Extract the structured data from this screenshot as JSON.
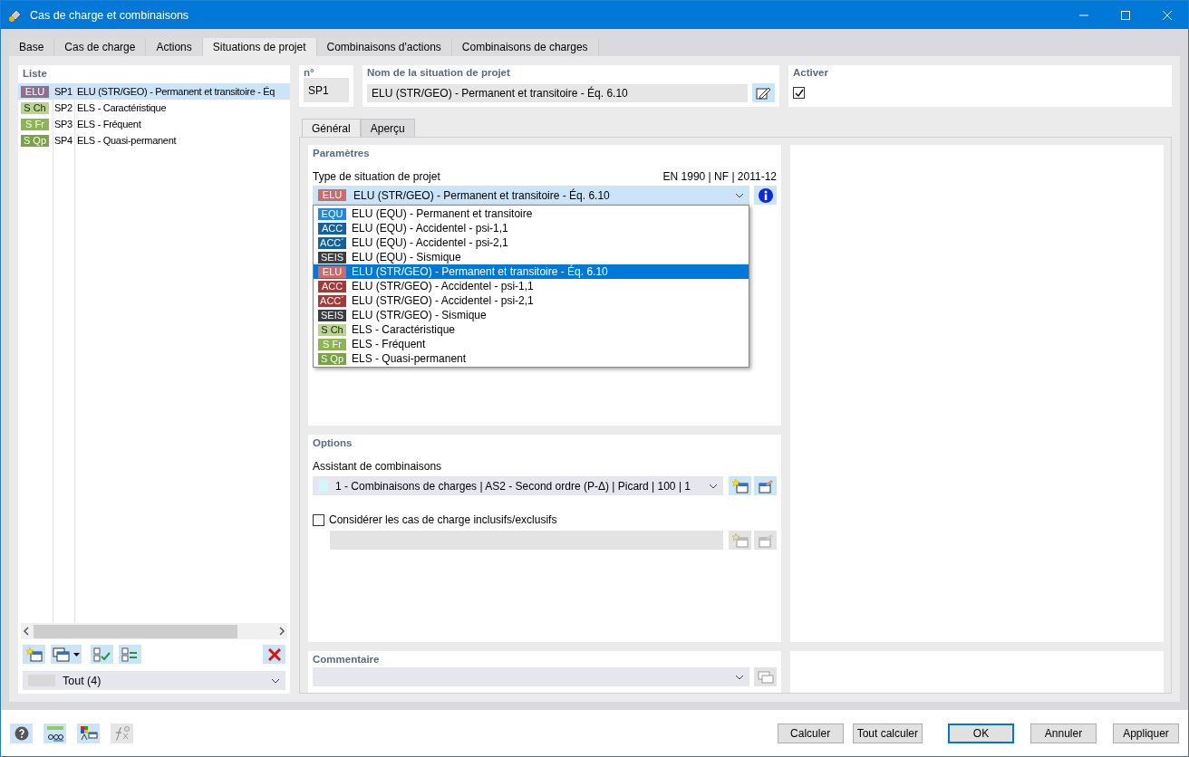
{
  "window": {
    "title": "Cas de charge et combinaisons"
  },
  "tabs": [
    {
      "label": "Base",
      "selected": false
    },
    {
      "label": "Cas de charge",
      "selected": false
    },
    {
      "label": "Actions",
      "selected": false
    },
    {
      "label": "Situations de projet",
      "selected": true
    },
    {
      "label": "Combinaisons d'actions",
      "selected": false
    },
    {
      "label": "Combinaisons de charges",
      "selected": false
    }
  ],
  "list": {
    "header": "Liste",
    "items": [
      {
        "badge": "ELU",
        "color": "#8e6f8e",
        "id": "SP1",
        "name": "ELU (STR/GEO) - Permanent et transitoire - Éq",
        "selected": true
      },
      {
        "badge": "S Ch",
        "color": "#b9d48e",
        "id": "SP2",
        "name": "ELS - Caractéristique",
        "selected": false
      },
      {
        "badge": "S Fr",
        "color": "#8db552",
        "id": "SP3",
        "name": "ELS - Fréquent",
        "selected": false
      },
      {
        "badge": "S Qp",
        "color": "#79a345",
        "id": "SP4",
        "name": "ELS - Quasi-permanent",
        "selected": false
      }
    ],
    "filter": "Tout (4)"
  },
  "number": {
    "label": "n°",
    "value": "SP1"
  },
  "name": {
    "label": "Nom de la situation de projet",
    "value": "ELU (STR/GEO) - Permanent et transitoire - Éq. 6.10"
  },
  "activate": {
    "label": "Activer",
    "checked": true
  },
  "inner_tabs": [
    {
      "label": "Général",
      "selected": true
    },
    {
      "label": "Aperçu",
      "selected": false
    }
  ],
  "parameters": {
    "title": "Paramètres",
    "type_label": "Type de situation de projet",
    "norm": "EN 1990 | NF | 2011-12",
    "value": {
      "badge": "ELU",
      "color": "#cd6b6b",
      "text": "ELU (STR/GEO) - Permanent et transitoire - Éq. 6.10"
    },
    "options": [
      {
        "badge": "EQU",
        "color": "#1e88e5",
        "text": "ELU (EQU) - Permanent et transitoire",
        "selected": false
      },
      {
        "badge": "ACC",
        "color": "#15609e",
        "text": "ELU (EQU) - Accidentel - psi-1,1",
        "selected": false
      },
      {
        "badge": "ACC´",
        "color": "#15609e",
        "text": "ELU (EQU) - Accidentel - psi-2,1",
        "selected": false
      },
      {
        "badge": "SEIS",
        "color": "#3a3c40",
        "text": "ELU (EQU) - Sismique",
        "selected": false
      },
      {
        "badge": "ELU",
        "color": "#cd6b6b",
        "text": "ELU (STR/GEO) - Permanent et transitoire - Éq. 6.10",
        "selected": true
      },
      {
        "badge": "ACC",
        "color": "#a33a3a",
        "text": "ELU (STR/GEO) - Accidentel - psi-1,1",
        "selected": false
      },
      {
        "badge": "ACC´",
        "color": "#a33a3a",
        "text": "ELU (STR/GEO) - Accidentel - psi-2,1",
        "selected": false
      },
      {
        "badge": "SEIS",
        "color": "#3a3c40",
        "text": "ELU (STR/GEO) - Sismique",
        "selected": false
      },
      {
        "badge": "S Ch",
        "color": "#b9d48e",
        "text": "ELS - Caractéristique",
        "selected": false
      },
      {
        "badge": "S Fr",
        "color": "#8db552",
        "text": "ELS - Fréquent",
        "selected": false
      },
      {
        "badge": "S Qp",
        "color": "#79a345",
        "text": "ELS - Quasi-permanent",
        "selected": false
      }
    ]
  },
  "options": {
    "title": "Options",
    "assistant_label": "Assistant de combinaisons",
    "assistant_value": "1 - Combinaisons de charges | AS2 - Second ordre (P-Δ) | Picard | 100 | 1",
    "consider": {
      "label": "Considérer les cas de charge inclusifs/exclusifs",
      "checked": false
    }
  },
  "comment": {
    "title": "Commentaire"
  },
  "buttons": [
    {
      "label": "Calculer",
      "default": false
    },
    {
      "label": "Tout calculer",
      "default": false
    },
    {
      "label": "OK",
      "default": true
    },
    {
      "label": "Annuler",
      "default": false
    },
    {
      "label": "Appliquer",
      "default": false
    }
  ]
}
